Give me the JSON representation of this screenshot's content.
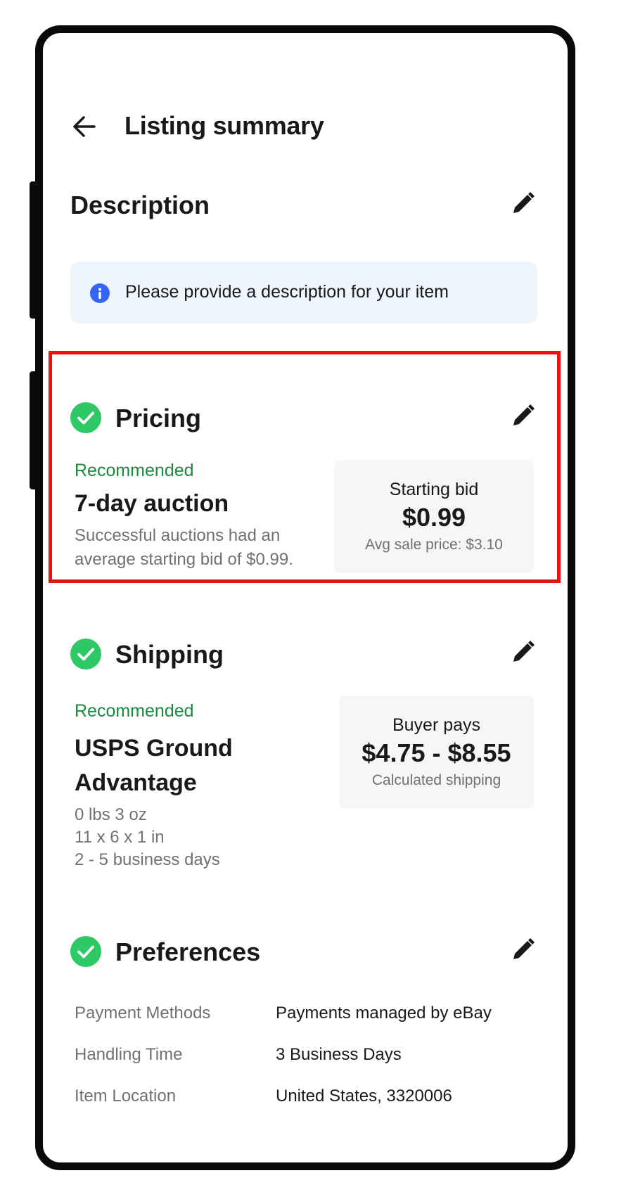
{
  "header": {
    "title": "Listing summary",
    "back_icon": "arrow-left-icon"
  },
  "description": {
    "title": "Description",
    "edit_icon": "pencil-icon",
    "info_text": "Please provide a description for your item",
    "info_icon": "info-icon"
  },
  "pricing": {
    "title": "Pricing",
    "status_icon": "check-circle-icon",
    "recommended": "Recommended",
    "format": "7-day auction",
    "detail_line1": "Successful auctions had an",
    "detail_line2": "average starting bid of $0.99.",
    "box_label": "Starting bid",
    "box_value": "$0.99",
    "box_note": "Avg sale price: $3.10"
  },
  "shipping": {
    "title": "Shipping",
    "status_icon": "check-circle-icon",
    "recommended": "Recommended",
    "service_line1": "USPS Ground",
    "service_line2": "Advantage",
    "weight": "0 lbs 3 oz",
    "dimensions": "11 x 6 x 1 in",
    "delivery": "2 - 5 business days",
    "box_label": "Buyer pays",
    "box_value": "$4.75 - $8.55",
    "box_note": "Calculated shipping"
  },
  "preferences": {
    "title": "Preferences",
    "status_icon": "check-circle-icon",
    "rows": [
      {
        "label": "Payment Methods",
        "value": "Payments managed by eBay"
      },
      {
        "label": "Handling Time",
        "value": "3 Business Days"
      },
      {
        "label": "Item Location",
        "value": "United States, 3320006"
      }
    ]
  },
  "colors": {
    "accent_green": "#1a8a3c",
    "check_green": "#2ec866",
    "info_blue": "#3665f3",
    "highlight_red": "#ee1111"
  }
}
